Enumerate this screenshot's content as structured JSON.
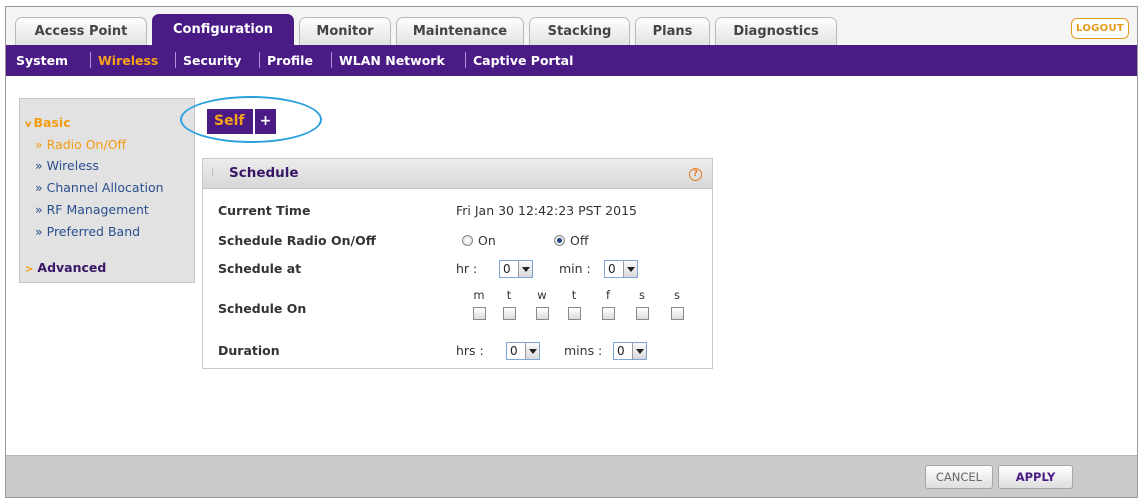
{
  "tabs": [
    {
      "label": "Access Point"
    },
    {
      "label": "Configuration"
    },
    {
      "label": "Monitor"
    },
    {
      "label": "Maintenance"
    },
    {
      "label": "Stacking"
    },
    {
      "label": "Plans"
    },
    {
      "label": "Diagnostics"
    }
  ],
  "logout_label": "LOGOUT",
  "subnav": [
    {
      "label": "System"
    },
    {
      "label": "Wireless"
    },
    {
      "label": "Security"
    },
    {
      "label": "Profile"
    },
    {
      "label": "WLAN Network"
    },
    {
      "label": "Captive Portal"
    }
  ],
  "sidebar": {
    "basic_label": "Basic",
    "items": [
      {
        "label": "» Radio On/Off"
      },
      {
        "label": "» Wireless"
      },
      {
        "label": "» Channel Allocation"
      },
      {
        "label": "» RF Management"
      },
      {
        "label": "» Preferred Band"
      }
    ],
    "advanced_label": "Advanced"
  },
  "toolbar": {
    "self_label": "Self",
    "plus_label": "+"
  },
  "panel": {
    "title": "Schedule",
    "help_label": "?",
    "rows": {
      "current_time_label": "Current Time",
      "current_time_value": "Fri Jan 30 12:42:23 PST 2015",
      "schedule_radio_label": "Schedule Radio On/Off",
      "radio_on_label": "On",
      "radio_off_label": "Off",
      "schedule_at_label": "Schedule at",
      "hr_label": "hr :",
      "hr_value": "0",
      "min_label": "min :",
      "min_value": "0",
      "schedule_on_label": "Schedule On",
      "days": [
        "m",
        "t",
        "w",
        "t",
        "f",
        "s",
        "s"
      ],
      "duration_label": "Duration",
      "hrs_label": "hrs :",
      "hrs_value": "0",
      "mins_label": "mins :",
      "mins_value": "0"
    }
  },
  "footer": {
    "cancel_label": "CANCEL",
    "apply_label": "APPLY"
  },
  "colors": {
    "brand_purple": "#4a1a85",
    "accent_orange": "#f39c12",
    "highlight_blue": "#2aa1de"
  }
}
